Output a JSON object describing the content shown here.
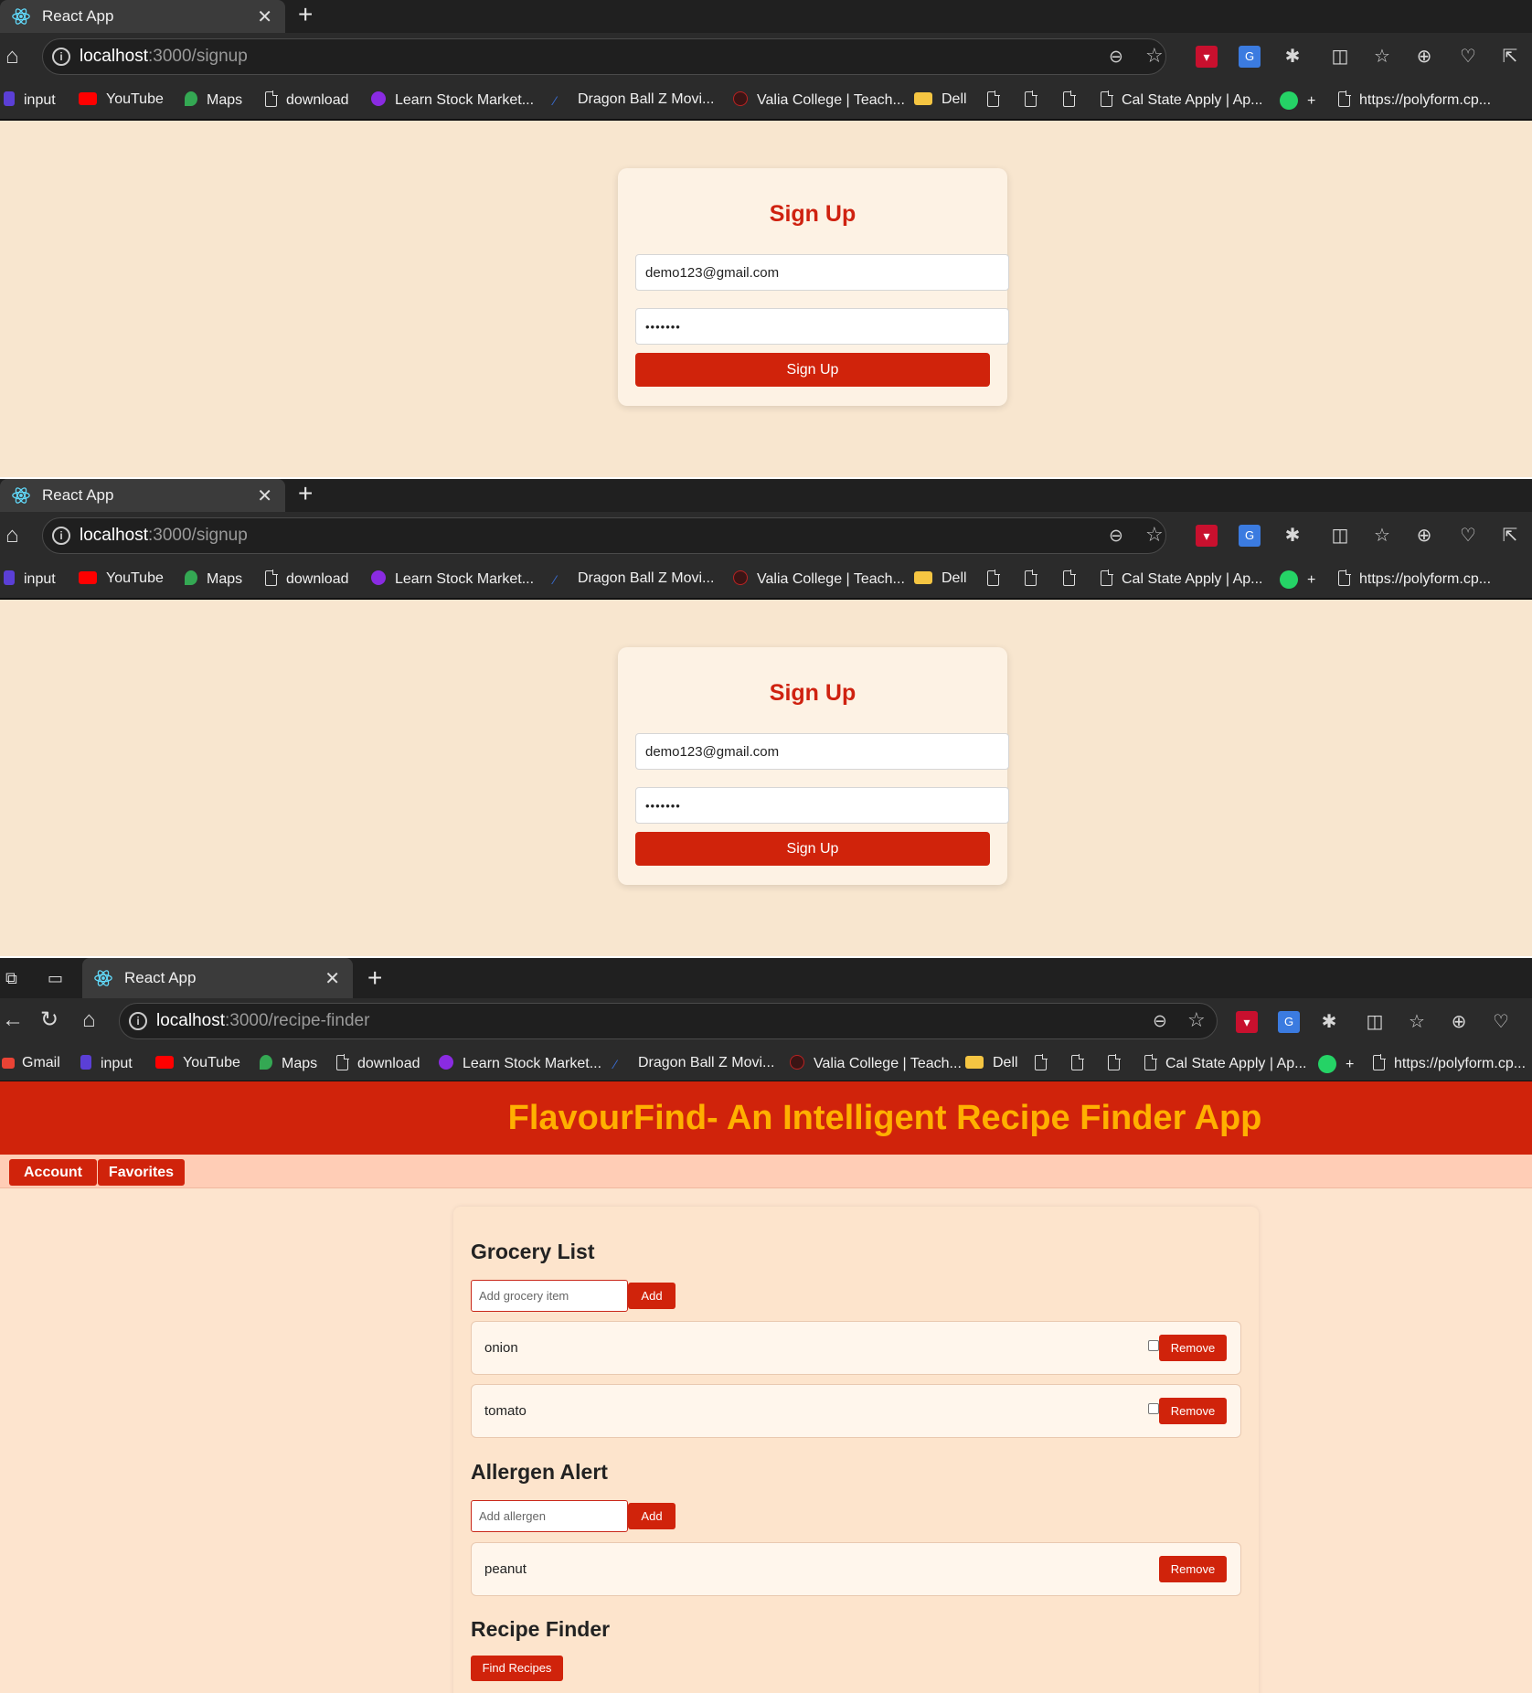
{
  "browser": {
    "tab_title": "React App",
    "bookmarks_signup": [
      "input",
      "YouTube",
      "Maps",
      "download",
      "Learn Stock Market...",
      "Dragon Ball Z Movi...",
      "Valia College | Teach...",
      "Dell",
      "Cal State Apply | Ap...",
      "+",
      "https://polyform.cp..."
    ],
    "bookmarks_app": [
      "Gmail",
      "input",
      "YouTube",
      "Maps",
      "download",
      "Learn Stock Market...",
      "Dragon Ball Z Movi...",
      "Valia College | Teach...",
      "Dell",
      "Cal State Apply | Ap...",
      "+",
      "https://polyform.cp..."
    ]
  },
  "signup_1": {
    "url_host": "localhost",
    "url_path": ":3000/signup",
    "title": "Sign Up",
    "email_value": "demo123@gmail.com",
    "password_mask": "•••••••",
    "button_label": "Sign Up"
  },
  "signup_2": {
    "url_host": "localhost",
    "url_path": ":3000/signup",
    "title": "Sign Up",
    "email_value": "demo123@gmail.com",
    "password_mask": "•••••••",
    "button_label": "Sign Up"
  },
  "app": {
    "url_host": "localhost",
    "url_path": ":3000/recipe-finder",
    "header_title": "FlavourFind- An Intelligent Recipe Finder App",
    "nav": {
      "account": "Account",
      "favorites": "Favorites"
    },
    "grocery": {
      "heading": "Grocery List",
      "placeholder": "Add grocery item",
      "add_label": "Add",
      "items": [
        {
          "name": "onion",
          "remove": "Remove"
        },
        {
          "name": "tomato",
          "remove": "Remove"
        }
      ]
    },
    "allergen": {
      "heading": "Allergen Alert",
      "placeholder": "Add allergen",
      "add_label": "Add",
      "items": [
        {
          "name": "peanut",
          "remove": "Remove"
        }
      ]
    },
    "finder": {
      "heading": "Recipe Finder",
      "button": "Find Recipes"
    }
  },
  "colors": {
    "accent": "#d0230b",
    "title_yellow": "#ffb000",
    "page_bg": "#f8e6cf"
  }
}
